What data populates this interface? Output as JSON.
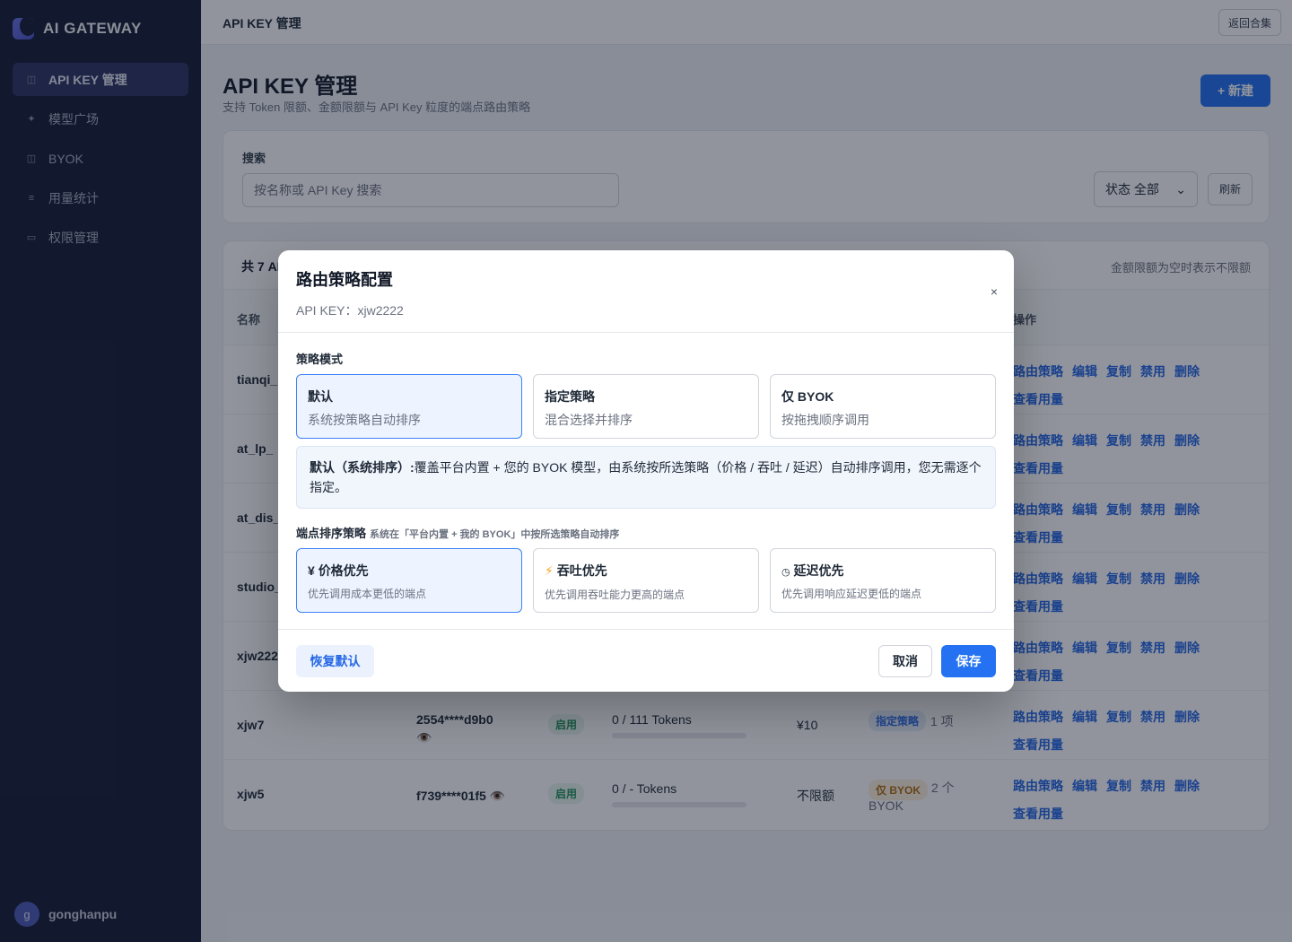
{
  "brand": {
    "name": "AI GATEWAY"
  },
  "sidebar": {
    "items": [
      {
        "label": "API KEY 管理",
        "icon": "◫",
        "active": true
      },
      {
        "label": "模型广场",
        "icon": "✦"
      },
      {
        "label": "BYOK",
        "icon": "◫"
      },
      {
        "label": "用量统计",
        "icon": "≡"
      },
      {
        "label": "权限管理",
        "icon": "▭"
      }
    ],
    "user": {
      "initial": "g",
      "name": "gonghanpu"
    }
  },
  "topbar": {
    "title": "API KEY 管理",
    "back_label": "返回合集"
  },
  "page": {
    "title": "API KEY 管理",
    "subtitle": "支持 Token 限额、金额限额与 API Key 粒度的端点路由策略",
    "new_label": "+ 新建"
  },
  "search": {
    "label": "搜索",
    "placeholder": "按名称或 API Key 搜索",
    "status_label": "状态 全部",
    "status_caret": "⌄",
    "refresh_label": "刷新"
  },
  "table": {
    "count_label": "共 7 AI",
    "note": "金额限额为空时表示不限额",
    "headers": {
      "name": "名称",
      "ops": "操作"
    },
    "op_labels": {
      "route": "路由策略",
      "edit": "编辑",
      "copy": "复制",
      "disable": "禁用",
      "delete": "删除",
      "usage": "查看用量"
    },
    "rows": [
      {
        "name": "tianqi_"
      },
      {
        "name": "at_lp_"
      },
      {
        "name": "at_dis_"
      },
      {
        "name": "studio_"
      },
      {
        "name": "xjw222"
      },
      {
        "name": "xjw7",
        "key": "2554****d9b0",
        "eye": "👁️",
        "status": "启用",
        "usage": "0 / 111 Tokens",
        "amount": "¥10",
        "policy": "指定策略",
        "policy_extra": "1 项"
      },
      {
        "name": "xjw5",
        "key": "f739****01f5",
        "eye": "👁️",
        "status": "启用",
        "usage": "0 / - Tokens",
        "amount": "不限额",
        "policy": "仅 BYOK",
        "policy_extra": "2 个",
        "policy_extra2": "BYOK"
      }
    ]
  },
  "modal": {
    "title": "路由策略配置",
    "subtitle": "API KEY：xjw2222",
    "close": "×",
    "mode_label": "策略模式",
    "modes": [
      {
        "title": "默认",
        "desc": "系统按策略自动排序",
        "selected": true
      },
      {
        "title": "指定策略",
        "desc": "混合选择并排序"
      },
      {
        "title": "仅 BYOK",
        "desc": "按拖拽顺序调用"
      }
    ],
    "info_bold": "默认（系统排序）:",
    "info_text": "覆盖平台内置 + 您的 BYOK 模型，由系统按所选策略（价格 / 吞吐 / 延迟）自动排序调用，您无需逐个指定。",
    "sort_label": "端点排序策略",
    "sort_hint": "系统在「平台内置 + 我的 BYOK」中按所选策略自动排序",
    "sorts": [
      {
        "icon": "¥",
        "title": "价格优先",
        "desc": "优先调用成本更低的端点",
        "selected": true
      },
      {
        "icon": "⚡",
        "title": "吞吐优先",
        "desc": "优先调用吞吐能力更高的端点"
      },
      {
        "icon": "◷",
        "title": "延迟优先",
        "desc": "优先调用响应延迟更低的端点"
      }
    ],
    "reset_label": "恢复默认",
    "cancel_label": "取消",
    "save_label": "保存"
  },
  "colors": {
    "accent": "#2472f2",
    "sidebar": "#161d36",
    "success": "#22915a",
    "warning": "#b06e12"
  }
}
